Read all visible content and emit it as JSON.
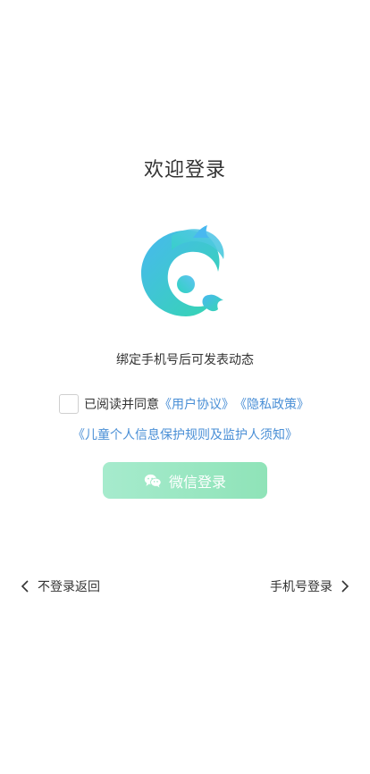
{
  "header": {
    "title": "欢迎登录"
  },
  "logo": {
    "icon": "app-logo-icon",
    "colors": [
      "#39d8c4",
      "#48b8f0",
      "#2fc7a8"
    ]
  },
  "main": {
    "subtitle": "绑定手机号后可发表动态",
    "agreement": {
      "checked": false,
      "prefix": "已阅读并同意",
      "user_agreement": "《用户协议》",
      "privacy_policy": "《隐私政策》",
      "children_policy": "《儿童个人信息保护规则及监护人须知》"
    },
    "wechat_button": {
      "label": "微信登录",
      "icon": "wechat-icon"
    }
  },
  "footer": {
    "back_label": "不登录返回",
    "back_icon": "chevron-left-icon",
    "phone_login_label": "手机号登录",
    "phone_login_icon": "chevron-right-icon"
  },
  "colors": {
    "link": "#4a8fd6",
    "button_gradient_start": "#a6ebcd",
    "button_gradient_end": "#8fe3b8"
  }
}
